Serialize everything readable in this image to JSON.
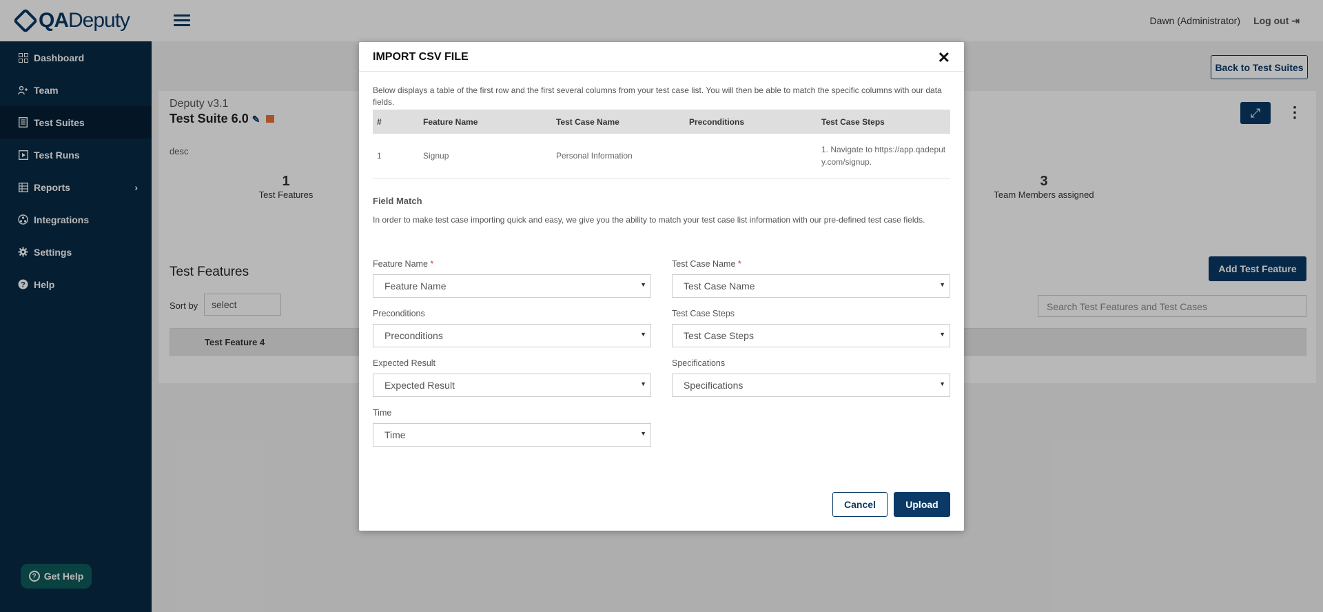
{
  "brand": {
    "qa": "QA",
    "deputy": "Deputy"
  },
  "sidebar": {
    "items": [
      {
        "label": "Dashboard"
      },
      {
        "label": "Team"
      },
      {
        "label": "Test Suites"
      },
      {
        "label": "Test Runs"
      },
      {
        "label": "Reports"
      },
      {
        "label": "Integrations"
      },
      {
        "label": "Settings"
      },
      {
        "label": "Help"
      }
    ],
    "get_help": "Get Help"
  },
  "topbar": {
    "user": "Dawn",
    "role": "(Administrator)",
    "logout": "Log out"
  },
  "main": {
    "back_button": "Back to Test Suites",
    "project": "Deputy v3.1",
    "suite_name": "Test Suite 6.0",
    "desc": "desc",
    "stats": [
      {
        "num": "1",
        "label": "Test Features"
      },
      {
        "num": "3",
        "label": "Team Members assigned"
      }
    ],
    "features_title": "Test Features",
    "add_feature": "Add Test Feature",
    "sort_label": "Sort by",
    "sort_value": "select",
    "search_placeholder": "Search Test Features and Test Cases",
    "feature_row": "Test Feature 4"
  },
  "modal": {
    "title": "IMPORT CSV FILE",
    "intro": "Below displays a table of the first row and the first several columns from your test case list. You will then be able to match the specific columns with our data fields.",
    "table": {
      "headers": [
        "#",
        "Feature Name",
        "Test Case Name",
        "Preconditions",
        "Test Case Steps"
      ],
      "row": [
        "1",
        "Signup",
        "Personal Information",
        "",
        "1. Navigate to https://app.qadeputy.com/signup."
      ]
    },
    "field_match_title": "Field Match",
    "field_match_desc": "In order to make test case importing quick and easy, we give you the ability to match your test case list information with our pre-defined test case fields.",
    "fields": [
      {
        "label": "Feature Name",
        "required": true,
        "value": "Feature Name"
      },
      {
        "label": "Test Case Name",
        "required": true,
        "value": "Test Case Name"
      },
      {
        "label": "Preconditions",
        "required": false,
        "value": "Preconditions"
      },
      {
        "label": "Test Case Steps",
        "required": false,
        "value": "Test Case Steps"
      },
      {
        "label": "Expected Result",
        "required": false,
        "value": "Expected Result"
      },
      {
        "label": "Specifications",
        "required": false,
        "value": "Specifications"
      },
      {
        "label": "Time",
        "required": false,
        "value": "Time"
      }
    ],
    "cancel": "Cancel",
    "upload": "Upload"
  },
  "colors": {
    "sidebar": "#082a45",
    "primary": "#0b3a66",
    "required": "#e03131",
    "help": "#0f5a5a"
  }
}
